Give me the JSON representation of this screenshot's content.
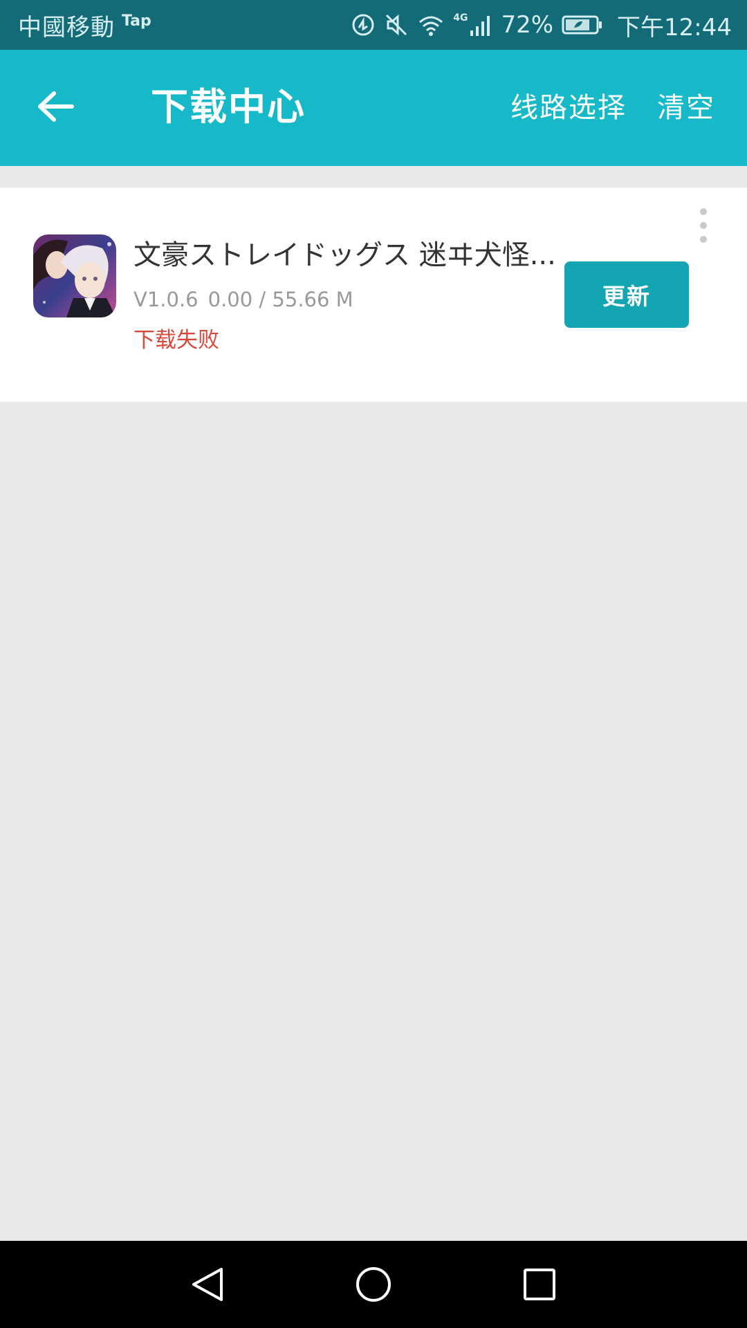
{
  "status_bar": {
    "carrier": "中國移動",
    "carrier_tag": "Tap",
    "network_label": "4G",
    "battery_percent": "72%",
    "time": "下午12:44",
    "icons": [
      "data-saver-icon",
      "mute-icon",
      "wifi-icon",
      "signal-icon",
      "battery-icon"
    ]
  },
  "app_bar": {
    "back_icon": "arrow-left-icon",
    "title": "下载中心",
    "route_select_label": "线路选择",
    "clear_label": "清空",
    "background_color": "#16b9c8"
  },
  "downloads": [
    {
      "icon": "game-app-icon",
      "name": "文豪ストレイドッグス 迷ヰ犬怪...",
      "version": "V1.0.6",
      "progress": "0.00 / 55.66 M",
      "status": "下载失败",
      "status_color": "#d9493b",
      "action_label": "更新",
      "more_icon": "more-vertical-icon"
    }
  ],
  "nav_bar": {
    "icons": [
      "nav-back-icon",
      "nav-home-icon",
      "nav-recent-icon"
    ]
  }
}
